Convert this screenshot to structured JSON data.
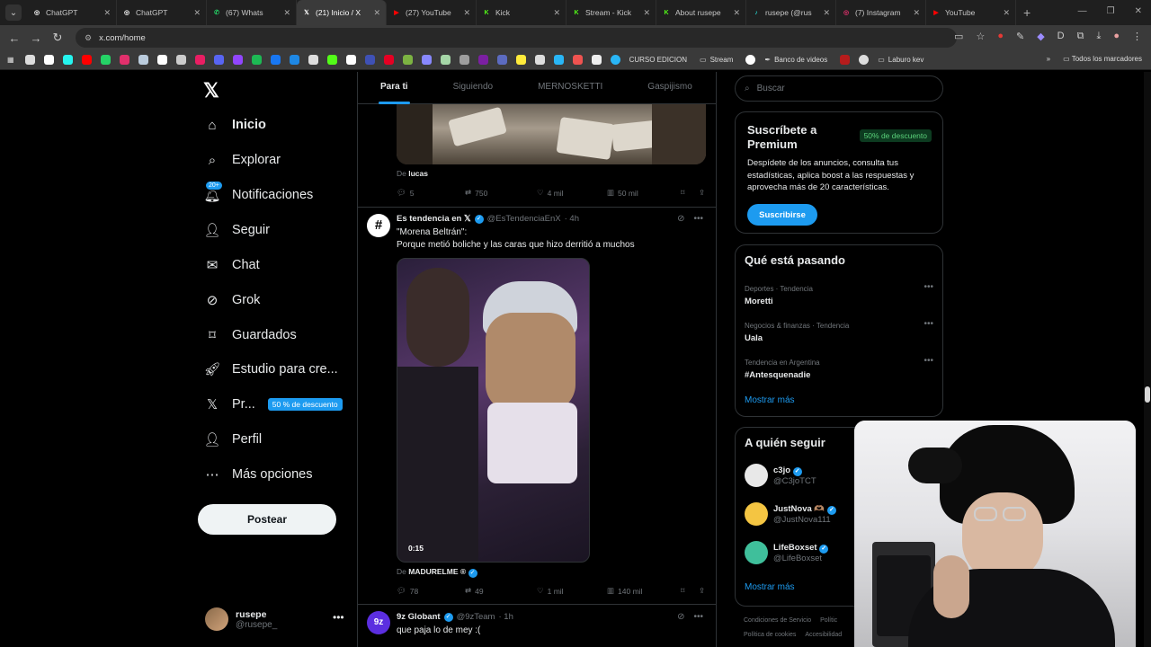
{
  "browser": {
    "tabs": [
      {
        "title": "ChatGPT",
        "color": "#ffffff",
        "glyph": "◎",
        "active": false
      },
      {
        "title": "ChatGPT",
        "color": "#ffffff",
        "glyph": "◎",
        "active": false
      },
      {
        "title": "(67) Whats",
        "color": "#25d366",
        "glyph": "✆",
        "active": false
      },
      {
        "title": "(21) Inicio / X",
        "color": "#ffffff",
        "glyph": "𝕏",
        "active": true
      },
      {
        "title": "(27) YouTube",
        "color": "#ff0000",
        "glyph": "▶",
        "active": false
      },
      {
        "title": "Kick",
        "color": "#53fc18",
        "glyph": "K",
        "active": false
      },
      {
        "title": "Stream - Kick",
        "color": "#53fc18",
        "glyph": "K",
        "active": false
      },
      {
        "title": "About rusepe",
        "color": "#53fc18",
        "glyph": "K",
        "active": false
      },
      {
        "title": "rusepe (@rus",
        "color": "#25f4ee",
        "glyph": "♪",
        "active": false
      },
      {
        "title": "(7) Instagram",
        "color": "#e1306c",
        "glyph": "◎",
        "active": false
      },
      {
        "title": "YouTube",
        "color": "#ff0000",
        "glyph": "▶",
        "active": false
      }
    ],
    "url": "x.com/home",
    "bookmarks": [
      {
        "label": "CURSO EDICION",
        "icon": "s-icon"
      },
      {
        "label": "Stream",
        "icon": "folder-icon"
      },
      {
        "label": "Banco de videos",
        "icon": "pen-icon"
      },
      {
        "label": "Laburo kev",
        "icon": "folder-icon"
      }
    ],
    "bookmarks_all": "Todos los marcadores"
  },
  "sidebar": {
    "items": [
      {
        "label": "Inicio",
        "icon": "home-icon"
      },
      {
        "label": "Explorar",
        "icon": "search-icon"
      },
      {
        "label": "Notificaciones",
        "icon": "bell-icon",
        "badge": "20+"
      },
      {
        "label": "Seguir",
        "icon": "add-user-icon"
      },
      {
        "label": "Chat",
        "icon": "mail-icon"
      },
      {
        "label": "Grok",
        "icon": "grok-icon"
      },
      {
        "label": "Guardados",
        "icon": "bookmark-icon"
      },
      {
        "label": "Estudio para cre...",
        "icon": "rocket-icon"
      },
      {
        "label": "Pr...",
        "icon": "x-icon",
        "promo": "50 % de descuento"
      },
      {
        "label": "Perfil",
        "icon": "user-icon"
      },
      {
        "label": "Más opciones",
        "icon": "more-circle-icon"
      }
    ],
    "post_button": "Postear",
    "account": {
      "name": "rusepe",
      "handle": "@rusepe_"
    }
  },
  "feed": {
    "tabs": [
      "Para ti",
      "Siguiendo",
      "MERNOSKETTI",
      "Gaspijismo"
    ],
    "post1": {
      "from_label": "De",
      "from_name": "lucas",
      "replies": "5",
      "reposts": "750",
      "likes": "4 mil",
      "views": "50 mil"
    },
    "post2": {
      "author": "Es tendencia en 𝕏",
      "handle": "@EsTendenciaEnX",
      "time": "· 4h",
      "line1": "\"Morena Beltrán\":",
      "line2": "Porque metió boliche y las caras que hizo derritió a muchos",
      "video_time": "0:15",
      "from_label": "De",
      "from_name": "MADURELME ®",
      "replies": "78",
      "reposts": "49",
      "likes": "1 mil",
      "views": "140 mil"
    },
    "post3": {
      "author": "9z Globant",
      "handle": "@9zTeam",
      "time": "· 1h",
      "text": "que paja lo de mey :("
    }
  },
  "right": {
    "search_placeholder": "Buscar",
    "premium": {
      "title": "Suscríbete a Premium",
      "badge": "50% de descuento",
      "text": "Despídete de los anuncios, consulta tus estadísticas, aplica boost a las respuestas y aprovecha más de 20 características.",
      "button": "Suscribirse"
    },
    "trends": {
      "title": "Qué está pasando",
      "items": [
        {
          "context": "Deportes · Tendencia",
          "name": "Moretti"
        },
        {
          "context": "Negocios & finanzas · Tendencia",
          "name": "Uala"
        },
        {
          "context": "Tendencia en Argentina",
          "name": "#Antesquenadie"
        }
      ],
      "more": "Mostrar más"
    },
    "follow": {
      "title": "A quién seguir",
      "items": [
        {
          "name": "c3jo",
          "handle": "@C3joTCT"
        },
        {
          "name": "JustNova 🫶🏽",
          "handle": "@JustNova111"
        },
        {
          "name": "LifeBoxset",
          "handle": "@LifeBoxset"
        }
      ],
      "more": "Mostrar más"
    },
    "footer": {
      "line1a": "Condiciones de Servicio",
      "line1b": "Polític",
      "line2a": "Política de cookies",
      "line2b": "Accesibilidad"
    }
  },
  "colors": {
    "accent": "#1d9bf0",
    "background": "#000000",
    "border": "#2f3336",
    "muted": "#71767b"
  }
}
